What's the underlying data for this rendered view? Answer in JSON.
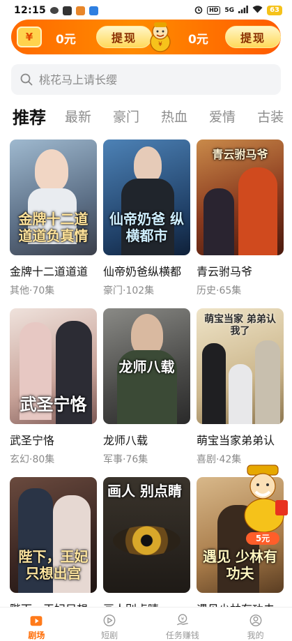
{
  "status_bar": {
    "time": "12:15",
    "hd_badge": "HD",
    "network": "5G",
    "battery": "63"
  },
  "reward_banner": {
    "wallet_symbol": "¥",
    "left_amount": "0元",
    "right_amount": "0元",
    "withdraw_label": "提现"
  },
  "search": {
    "placeholder": "桃花马上请长缨"
  },
  "tabs": [
    {
      "label": "推荐",
      "active": true
    },
    {
      "label": "最新",
      "active": false
    },
    {
      "label": "豪门",
      "active": false
    },
    {
      "label": "热血",
      "active": false
    },
    {
      "label": "爱情",
      "active": false
    },
    {
      "label": "古装",
      "active": false
    }
  ],
  "dramas": [
    {
      "title": "金牌十二道道道",
      "poster_text": "金牌十二道 道道负真情",
      "genre": "其他",
      "episodes": "70集",
      "meta": "其他·70集",
      "bg": "#6a88a8"
    },
    {
      "title": "仙帝奶爸纵横都",
      "poster_text": "仙帝奶爸 纵横都市",
      "genre": "豪门",
      "episodes": "102集",
      "meta": "豪门·102集",
      "bg": "#2d5b8a"
    },
    {
      "title": "青云驸马爷",
      "poster_text": "青云驸马爷",
      "genre": "历史",
      "episodes": "65集",
      "meta": "历史·65集",
      "bg": "#9a4a2a"
    },
    {
      "title": "武圣宁恪",
      "poster_text": "武圣宁恪",
      "genre": "玄幻",
      "episodes": "80集",
      "meta": "玄幻·80集",
      "bg": "#c7a79b"
    },
    {
      "title": "龙师八载",
      "poster_text": "龙师八载",
      "genre": "军事",
      "episodes": "76集",
      "meta": "军事·76集",
      "bg": "#5b5b58"
    },
    {
      "title": "萌宝当家弟弟认",
      "poster_text": "萌宝当家 弟弟认我了",
      "genre": "喜剧",
      "episodes": "42集",
      "meta": "喜剧·42集",
      "bg": "#cfb990"
    },
    {
      "title": "陛下，王妃只想",
      "poster_text": "陛下，王妃 只想出宫",
      "genre": "",
      "episodes": "",
      "meta": "",
      "bg": "#3e2c2a"
    },
    {
      "title": "画人别点睛",
      "poster_text": "画人 别点睛",
      "genre": "",
      "episodes": "",
      "meta": "",
      "bg": "#2a2622"
    },
    {
      "title": "遇见少林有功夫",
      "poster_text": "遇见 少林有功夫",
      "genre": "",
      "episodes": "",
      "meta": "",
      "bg": "#a87b49"
    }
  ],
  "floating_reward": {
    "amount": "5元"
  },
  "bottom_nav": [
    {
      "label": "剧场",
      "icon": "clapperboard-icon",
      "active": true
    },
    {
      "label": "短剧",
      "icon": "play-circle-icon",
      "active": false
    },
    {
      "label": "任务赚钱",
      "icon": "coin-hand-icon",
      "active": false
    },
    {
      "label": "我的",
      "icon": "profile-icon",
      "active": false
    }
  ],
  "colors": {
    "brand_orange": "#ff6a00",
    "withdraw_button": "#ffd95a",
    "text_muted": "#8a8a8a"
  }
}
